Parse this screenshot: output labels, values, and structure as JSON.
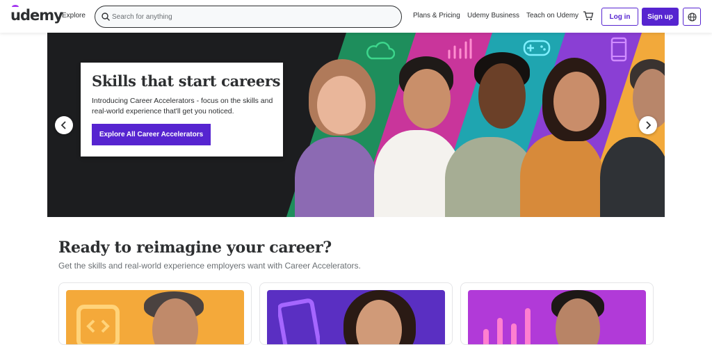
{
  "header": {
    "logo": "udemy",
    "explore": "Explore",
    "search_placeholder": "Search for anything",
    "plans_pricing": "Plans & Pricing",
    "udemy_business": "Udemy Business",
    "teach": "Teach on Udemy",
    "login": "Log in",
    "signup": "Sign up"
  },
  "hero": {
    "title": "Skills that start careers",
    "text": "Introducing Career Accelerators - focus on the skills and real-world experience that'll get you noticed.",
    "button": "Explore All Career Accelerators"
  },
  "section": {
    "title": "Ready to reimagine your career?",
    "subtitle": "Get the skills and real-world experience employers want with Career Accelerators."
  },
  "colors": {
    "brand": "#5624d0",
    "accent": "#a435f0",
    "text": "#2d2f31"
  },
  "icons": [
    "search-icon",
    "cart-icon",
    "globe-icon",
    "chevron-left-icon",
    "chevron-right-icon",
    "cloud-icon",
    "chart-icon",
    "gamepad-icon",
    "phone-icon",
    "code-icon"
  ]
}
